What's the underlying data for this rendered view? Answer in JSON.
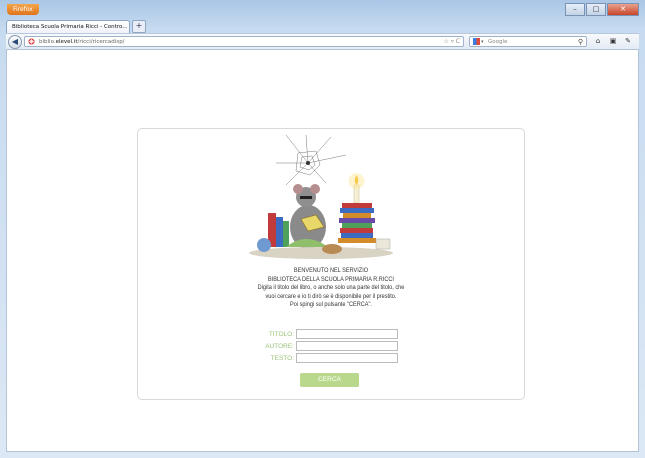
{
  "browser": {
    "menu_button": "Firefox",
    "tab_title": "Biblioteca Scuola Primaria Ricci - Contro...",
    "tab_close": "×",
    "new_tab": "+",
    "url_prefix": "biblio.",
    "url_domain": "elevel.it",
    "url_path": "/ricci/ricercadisp/",
    "search_placeholder": "Google",
    "window_controls": {
      "minimize": "–",
      "maximize": "□",
      "close": "✕"
    },
    "icons": [
      "back-arrow-icon",
      "star-icon",
      "reload-icon",
      "google-icon",
      "magnifier-icon",
      "home-icon",
      "bookmarks-icon",
      "tools-icon"
    ]
  },
  "page": {
    "welcome_line1": "BENVENUTO NEL SERVIZIO",
    "welcome_line2": "BIBLIOTECA DELLA SCUOLA PRIMARIA R.RICCI",
    "instructions_line1": "Digita il titolo del libro, o anche solo una parte del titolo, che",
    "instructions_line2": "vuoi cercare e io ti dirò se è disponibile per il prestito.",
    "instructions_line3": "Poi spingi sul pulsante \"CERCA\".",
    "form": {
      "titolo_label": "TITOLO:",
      "titolo_value": "",
      "autore_label": "AUTORE:",
      "autore_value": "",
      "testo_label": "TESTO:",
      "testo_value": "",
      "submit_label": "CERCA"
    },
    "colors": {
      "label_green": "#9cc47a",
      "button_green": "#b9d88c"
    }
  }
}
